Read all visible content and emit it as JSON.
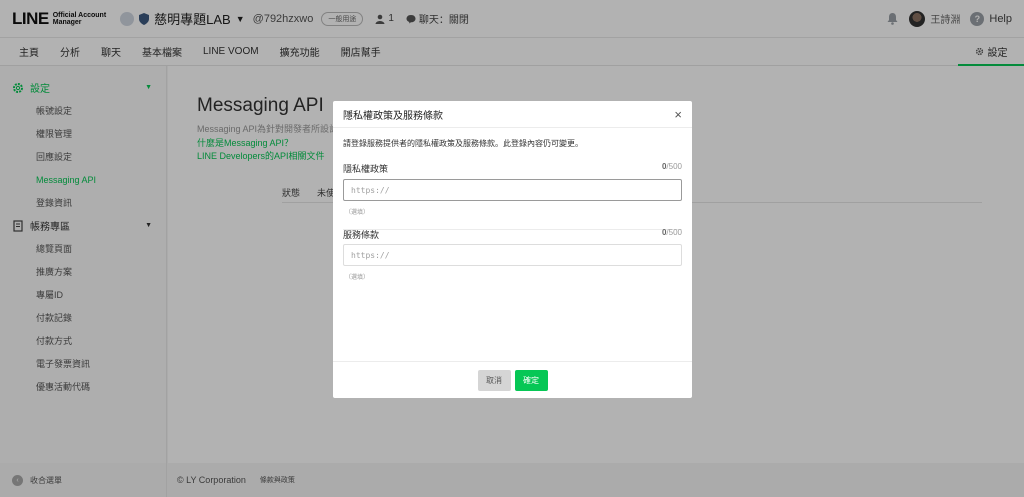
{
  "brand": {
    "logo_main": "LINE",
    "logo_sub_1": "Official Account",
    "logo_sub_2": "Manager",
    "accent": "#06c755"
  },
  "account": {
    "name": "慈明專題LAB",
    "id": "@792hzxwo",
    "badge": "一般用途",
    "friends": "1",
    "chat_status": "聊天：關閉"
  },
  "user": {
    "name": "王詩淵",
    "help": "Help"
  },
  "nav": {
    "items": [
      "主頁",
      "分析",
      "聊天",
      "基本檔案",
      "LINE VOOM",
      "擴充功能",
      "開店幫手"
    ],
    "settings": "設定"
  },
  "sidebar": {
    "group1": {
      "label": "設定",
      "items": [
        "帳號設定",
        "權限管理",
        "回應設定",
        "Messaging API",
        "登錄資訊"
      ]
    },
    "group2": {
      "label": "帳務專區",
      "items": [
        "總覽頁面",
        "推廣方案",
        "專屬ID",
        "付款記錄",
        "付款方式",
        "電子發票資訊",
        "優惠活動代碼"
      ]
    },
    "footer": "收合選單"
  },
  "main": {
    "title": "Messaging API",
    "desc": "Messaging API為針對開發者所設計",
    "link1": "什麼是Messaging API？",
    "link2": "LINE Developers的API相關文件",
    "status_label": "狀態",
    "status_value": "未使"
  },
  "footer": {
    "copyright": "© LY Corporation",
    "privacy": "條款與政策"
  },
  "modal": {
    "title": "隱私權政策及服務條款",
    "close": "×",
    "desc": "請登錄服務提供者的隱私權政策及服務條款。此登錄內容仍可變更。",
    "privacy": {
      "label": "隱私權政策",
      "count": "0",
      "max": "/500",
      "placeholder": "https://",
      "hint": "（選填）"
    },
    "terms": {
      "label": "服務條款",
      "count": "0",
      "max": "/500",
      "placeholder": "https://",
      "hint": "（選填）"
    },
    "cancel": "取消",
    "ok": "確定"
  }
}
